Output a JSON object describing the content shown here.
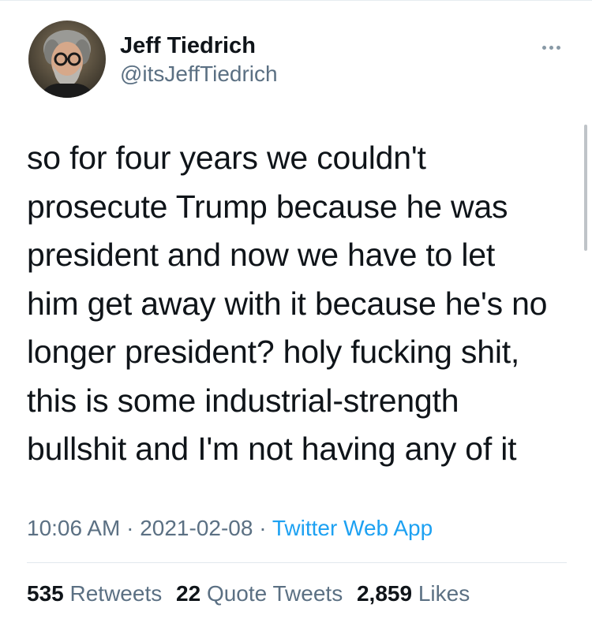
{
  "tweet": {
    "author": {
      "display_name": "Jeff Tiedrich",
      "handle": "@itsJeffTiedrich",
      "avatar_icon": "profile-photo"
    },
    "more_icon": "more-horizontal-icon",
    "text_lines": [
      "so for four years we couldn't",
      "prosecute Trump because he was",
      "president and now we have to let",
      "him get away with it because he's no",
      "longer president? holy fucking shit,",
      "this is some industrial-strength",
      "bullshit and I'm not having any of it"
    ],
    "time": "10:06 AM",
    "separator": "·",
    "date": "2021-02-08",
    "source": "Twitter Web App",
    "stats": {
      "retweets_count": "535",
      "retweets_label": "Retweets",
      "quote_tweets_count": "22",
      "quote_tweets_label": "Quote Tweets",
      "likes_count": "2,859",
      "likes_label": "Likes"
    }
  },
  "colors": {
    "text_primary": "#0f1419",
    "text_secondary": "#5b7083",
    "link": "#1da1f2",
    "divider": "#e1e8ed"
  }
}
